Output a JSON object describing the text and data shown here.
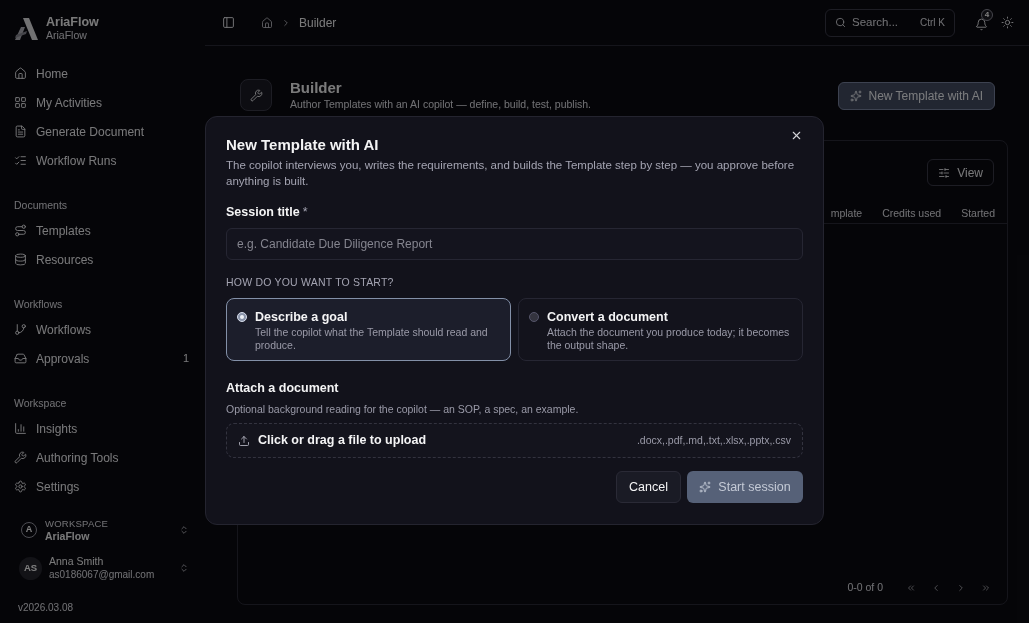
{
  "sidebar": {
    "brand": {
      "name": "AriaFlow",
      "subtitle": "AriaFlow"
    },
    "groups": [
      {
        "items": [
          {
            "label": "Home"
          },
          {
            "label": "My Activities"
          },
          {
            "label": "Generate Document"
          },
          {
            "label": "Workflow Runs"
          }
        ]
      },
      {
        "heading": "Documents",
        "items": [
          {
            "label": "Templates"
          },
          {
            "label": "Resources"
          }
        ]
      },
      {
        "heading": "Workflows",
        "items": [
          {
            "label": "Workflows"
          },
          {
            "label": "Approvals",
            "badge": "1"
          }
        ]
      },
      {
        "heading": "Workspace",
        "items": [
          {
            "label": "Insights"
          },
          {
            "label": "Authoring Tools"
          },
          {
            "label": "Settings"
          }
        ]
      }
    ],
    "workspace": {
      "label": "WORKSPACE",
      "name": "AriaFlow",
      "avatar": "A"
    },
    "user": {
      "initials": "AS",
      "name": "Anna Smith",
      "email": "as0186067@gmail.com"
    },
    "version": "v2026.03.08"
  },
  "topbar": {
    "breadcrumb": [
      "Builder"
    ],
    "search": {
      "placeholder": "Search...",
      "shortcut": "Ctrl K"
    },
    "notifications": {
      "count": "4"
    }
  },
  "page": {
    "title": "Builder",
    "subtitle": "Author Templates with an AI copilot — define, build, test, publish.",
    "action": "New Template with AI"
  },
  "table": {
    "view_button": "View",
    "columns": [
      "mplate",
      "Credits used",
      "Started"
    ],
    "pagination": "0-0 of 0"
  },
  "dialog": {
    "title": "New Template with AI",
    "description": "The copilot interviews you, writes the requirements, and builds the Template step by step — you approve before anything is built.",
    "session_title": {
      "label": "Session title",
      "required_mark": "*",
      "placeholder": "e.g. Candidate Due Diligence Report"
    },
    "start_heading": "HOW DO YOU WANT TO START?",
    "options": [
      {
        "title": "Describe a goal",
        "description": "Tell the copilot what the Template should read and produce.",
        "selected": true
      },
      {
        "title": "Convert a document",
        "description": "Attach the document you produce today; it becomes the output shape.",
        "selected": false
      }
    ],
    "attach": {
      "label": "Attach a document",
      "hint": "Optional background reading for the copilot — an SOP, a spec, an example.",
      "dropzone": "Click or drag a file to upload",
      "formats": ".docx,.pdf,.md,.txt,.xlsx,.pptx,.csv"
    },
    "buttons": [
      {
        "label": "Cancel",
        "kind": "secondary",
        "disabled": false
      },
      {
        "label": "Start session",
        "kind": "primary",
        "disabled": true
      }
    ]
  }
}
